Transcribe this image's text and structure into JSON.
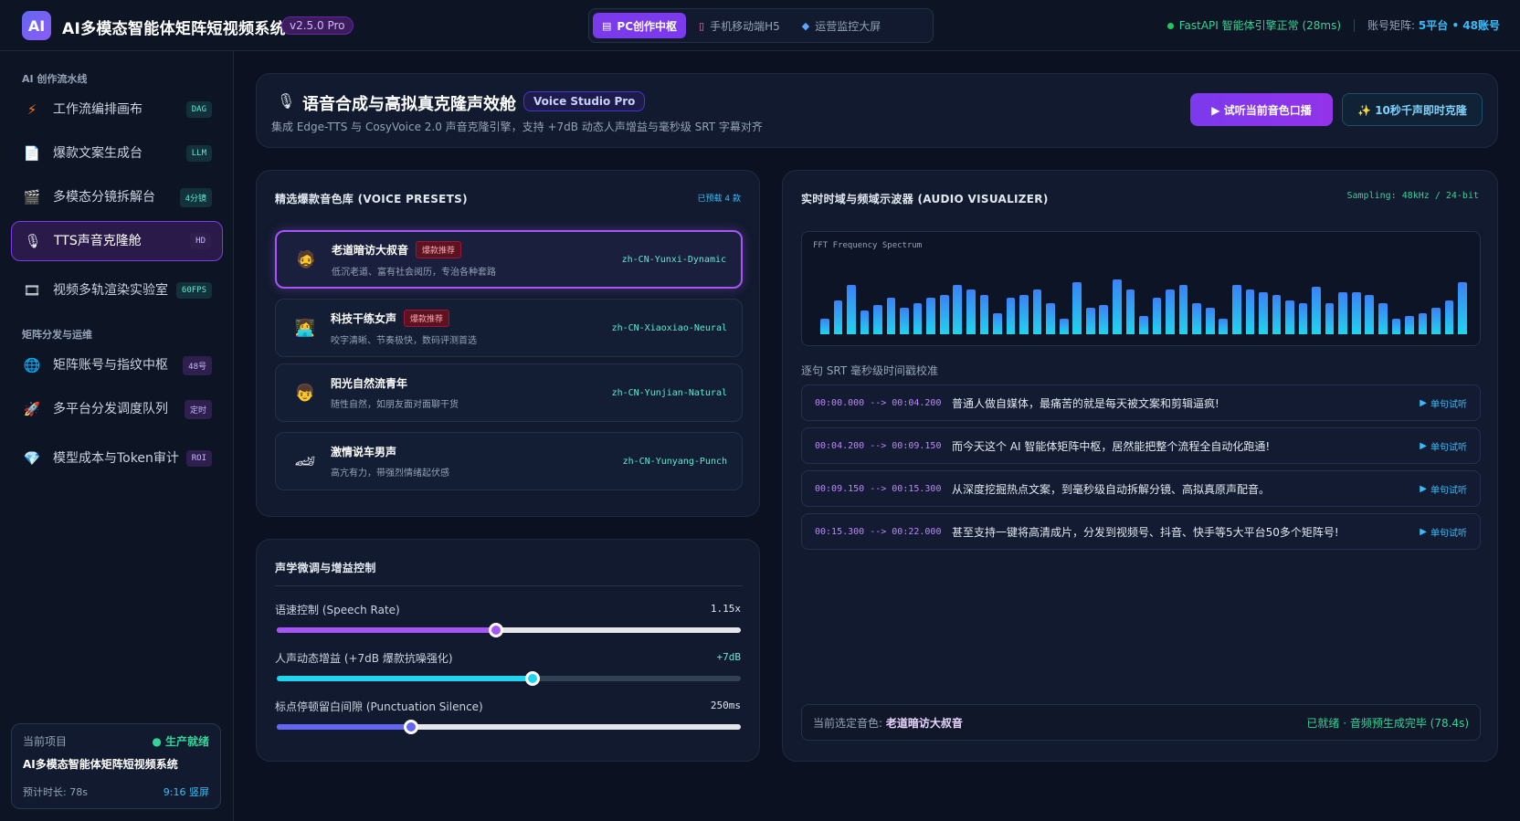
{
  "app": {
    "logo_text": "AI",
    "title": "AI多模态智能体矩阵短视频系统",
    "version": "v2.5.0 Pro"
  },
  "modes": [
    {
      "icon": "monitor-icon",
      "glyph": "▤",
      "label": "PC创作中枢",
      "active": true
    },
    {
      "icon": "phone-icon",
      "glyph": "▯",
      "label": "手机移动端H5",
      "active": false
    },
    {
      "icon": "shield-icon",
      "glyph": "◆",
      "label": "运营监控大屏",
      "active": false
    }
  ],
  "status": {
    "engine": "FastAPI 智能体引擎正常 (28ms)",
    "matrix_label": "账号矩阵:",
    "matrix_value": "5平台 • 48账号"
  },
  "sidebar": {
    "section1": "AI 创作流水线",
    "section2": "矩阵分发与运维",
    "items": [
      {
        "icon": "lightning-icon",
        "glyph": "⚡",
        "label": "工作流编排画布",
        "badge": "DAG"
      },
      {
        "icon": "document-icon",
        "glyph": "📄",
        "label": "爆款文案生成台",
        "badge": "LLM"
      },
      {
        "icon": "clapper-icon",
        "glyph": "🎬",
        "label": "多模态分镜拆解台",
        "badge": "4分镜"
      },
      {
        "icon": "microphone-icon",
        "glyph": "🎙",
        "label": "TTS声音克隆舱",
        "badge": "HD"
      },
      {
        "icon": "film-icon",
        "glyph": "🎞",
        "label": "视频多轨渲染实验室",
        "badge": "60FPS"
      },
      {
        "icon": "globe-icon",
        "glyph": "🌐",
        "label": "矩阵账号与指纹中枢",
        "badge": "48号"
      },
      {
        "icon": "rocket-icon",
        "glyph": "🚀",
        "label": "多平台分发调度队列",
        "badge": "定时"
      },
      {
        "icon": "gem-icon",
        "glyph": "💎",
        "label": "模型成本与Token审计",
        "badge": "ROI"
      }
    ]
  },
  "project": {
    "label": "当前项目",
    "status": "● 生产就绪",
    "name": "AI多模态智能体矩阵短视频系统",
    "duration": "预计时长: 78s",
    "ratio": "9:16 竖屏"
  },
  "header": {
    "icon": "microphone-icon",
    "title": "语音合成与高拟真克隆声效舱",
    "badge": "Voice Studio Pro",
    "subtitle": "集成 Edge-TTS 与 CosyVoice 2.0 声音克隆引擎，支持 +7dB 动态人声增益与毫秒级 SRT 字幕对齐",
    "btn_primary": "▶ 试听当前音色口播",
    "btn_secondary": "✨ 10秒千声即时克隆"
  },
  "voices": {
    "title": "精选爆款音色库 (VOICE PRESETS)",
    "meta": "已预载 4 款",
    "items": [
      {
        "avatar": "🧔",
        "name": "老道暗访大叔音",
        "tag": "爆款推荐",
        "desc": "低沉老道、富有社会阅历，专治各种套路",
        "id": "zh-CN-Yunxi-Dynamic",
        "selected": true
      },
      {
        "avatar": "👩‍💻",
        "name": "科技干练女声",
        "tag": "爆款推荐",
        "desc": "咬字清晰、节奏极快，数码评测首选",
        "id": "zh-CN-Xiaoxiao-Neural",
        "selected": false
      },
      {
        "avatar": "👦",
        "name": "阳光自然流青年",
        "tag": "",
        "desc": "随性自然，如朋友面对面聊干货",
        "id": "zh-CN-Yunjian-Natural",
        "selected": false
      },
      {
        "avatar": "🏎",
        "name": "激情说车男声",
        "tag": "",
        "desc": "高亢有力，带强烈情绪起伏感",
        "id": "zh-CN-Yunyang-Punch",
        "selected": false
      }
    ]
  },
  "acoustic": {
    "title": "声学微调与增益控制",
    "sliders": [
      {
        "label": "语速控制 (Speech Rate)",
        "value": "1.15x",
        "fraction": 0.472,
        "color": "#a855f7"
      },
      {
        "label": "人声动态增益 (+7dB 爆款抗噪强化)",
        "value": "+7dB",
        "fraction": 0.551,
        "color": "#22d3ee"
      },
      {
        "label": "标点停顿留白间隙 (Punctuation Silence)",
        "value": "250ms",
        "fraction": 0.289,
        "color": "#6366f1"
      }
    ]
  },
  "visualizer": {
    "title": "实时时域与频域示波器 (AUDIO VISUALIZER)",
    "sampling": "Sampling: 48kHz / 24-bit",
    "spectrum_label": "FFT Frequency Spectrum",
    "spectrum_levels": [
      0.12,
      0.26,
      0.38,
      0.18,
      0.22,
      0.28,
      0.2,
      0.24,
      0.28,
      0.3,
      0.38,
      0.34,
      0.3,
      0.16,
      0.28,
      0.3,
      0.34,
      0.24,
      0.12,
      0.4,
      0.2,
      0.22,
      0.42,
      0.34,
      0.14,
      0.28,
      0.34,
      0.38,
      0.24,
      0.2,
      0.12,
      0.38,
      0.34,
      0.32,
      0.3,
      0.26,
      0.24,
      0.36,
      0.24,
      0.32,
      0.32,
      0.3,
      0.24,
      0.12,
      0.14,
      0.16,
      0.2,
      0.26,
      0.4
    ],
    "srt_title": "逐句 SRT 毫秒级时间戳校准",
    "srt": [
      {
        "time": "00:00.000 --> 00:04.200",
        "text": "普通人做自媒体，最痛苦的就是每天被文案和剪辑逼疯!",
        "btn": "单句试听"
      },
      {
        "time": "00:04.200 --> 00:09.150",
        "text": "而今天这个 AI 智能体矩阵中枢，居然能把整个流程全自动化跑通!",
        "btn": "单句试听"
      },
      {
        "time": "00:09.150 --> 00:15.300",
        "text": "从深度挖掘热点文案，到毫秒级自动拆解分镜、高拟真原声配音。",
        "btn": "单句试听"
      },
      {
        "time": "00:15.300 --> 00:22.000",
        "text": "甚至支持一键将高清成片，分发到视频号、抖音、快手等5大平台50多个矩阵号!",
        "btn": "单句试听"
      }
    ],
    "footer_label": "当前选定音色:",
    "footer_voice": "老道暗访大叔音",
    "footer_status": "已就绪 · 音频预生成完毕 (78.4s)"
  }
}
